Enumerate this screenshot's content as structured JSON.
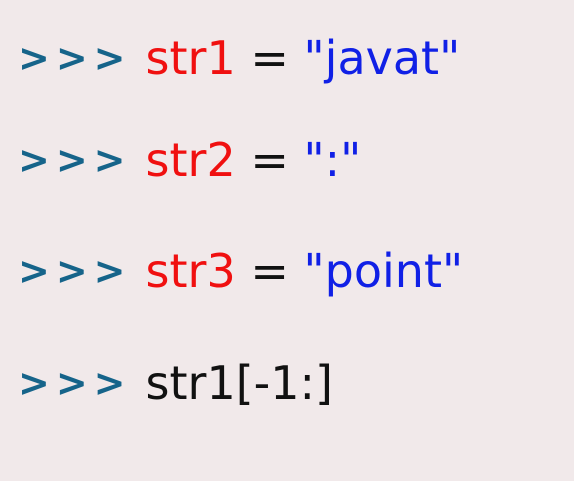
{
  "colors": {
    "background": "#f1e9ea",
    "prompt": "#16648a",
    "variable": "#f01010",
    "string": "#1020e6",
    "plain": "#111111"
  },
  "lines": [
    {
      "prompt": ">>>",
      "variable": "str1",
      "operator": " = ",
      "string": "\"javat\""
    },
    {
      "prompt": ">>>",
      "variable": "str2",
      "operator": " = ",
      "string": "\":\""
    },
    {
      "prompt": ">>>",
      "variable": "str3",
      "operator": " = ",
      "string": "\"point\""
    },
    {
      "prompt": ">>>",
      "expression": "str1[-1:]"
    }
  ]
}
